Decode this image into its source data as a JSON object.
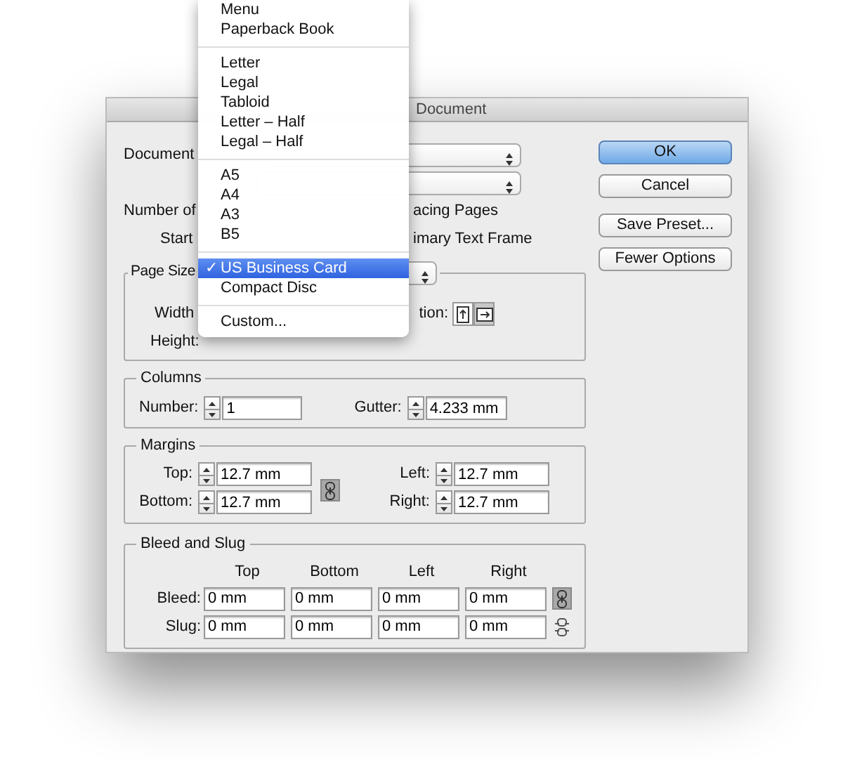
{
  "window": {
    "title": "Document"
  },
  "preset_menu": {
    "groups": [
      [
        {
          "label": "Menu",
          "selected": false
        },
        {
          "label": "Paperback Book",
          "selected": false
        }
      ],
      [
        {
          "label": "Letter",
          "selected": false
        },
        {
          "label": "Legal",
          "selected": false
        },
        {
          "label": "Tabloid",
          "selected": false
        },
        {
          "label": "Letter – Half",
          "selected": false
        },
        {
          "label": "Legal – Half",
          "selected": false
        }
      ],
      [
        {
          "label": "A5",
          "selected": false
        },
        {
          "label": "A4",
          "selected": false
        },
        {
          "label": "A3",
          "selected": false
        },
        {
          "label": "B5",
          "selected": false
        }
      ],
      [
        {
          "label": "US Business Card",
          "selected": true
        },
        {
          "label": "Compact Disc",
          "selected": false
        }
      ],
      [
        {
          "label": "Custom...",
          "selected": false
        }
      ]
    ],
    "check_mark": "✓"
  },
  "top_labels": {
    "document": "Document",
    "number_of": "Number of",
    "start": "Start",
    "facing_pages": "acing Pages",
    "primary_text_frame": "imary Text Frame"
  },
  "page_size": {
    "legend": "Page Size",
    "width_label": "Width",
    "orientation_label": "tion:",
    "height_label": "Height:",
    "orientation": [
      {
        "selected": false
      },
      {
        "selected": true
      }
    ]
  },
  "columns": {
    "legend": "Columns",
    "number_label": "Number:",
    "number": "1",
    "gutter_label": "Gutter:",
    "gutter": "4.233 mm"
  },
  "margins": {
    "legend": "Margins",
    "linked": true,
    "fields": [
      {
        "label": "Top:",
        "value": "12.7 mm"
      },
      {
        "label": "Left:",
        "value": "12.7 mm"
      },
      {
        "label": "Bottom:",
        "value": "12.7 mm"
      },
      {
        "label": "Right:",
        "value": "12.7 mm"
      }
    ]
  },
  "bleed_slug": {
    "legend": "Bleed and Slug",
    "headers": [
      "Top",
      "Bottom",
      "Left",
      "Right"
    ],
    "rows": [
      {
        "label": "Bleed:",
        "values": [
          "0 mm",
          "0 mm",
          "0 mm",
          "0 mm"
        ],
        "linked": true
      },
      {
        "label": "Slug:",
        "values": [
          "0 mm",
          "0 mm",
          "0 mm",
          "0 mm"
        ],
        "linked": false
      }
    ]
  },
  "buttons": [
    {
      "label": "OK",
      "default": true
    },
    {
      "label": "Cancel",
      "default": false
    },
    {
      "label": "Save Preset...",
      "default": false
    },
    {
      "label": "Fewer Options",
      "default": false
    }
  ]
}
